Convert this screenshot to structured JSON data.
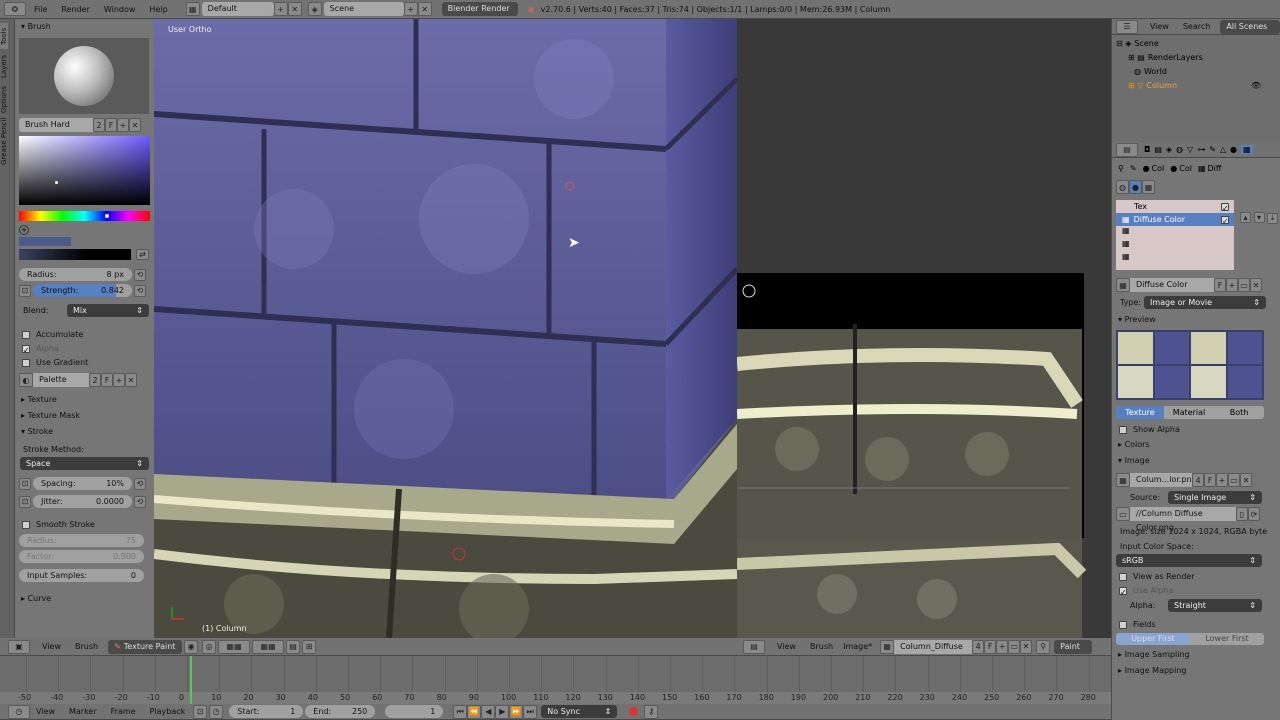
{
  "topbar": {
    "menus": [
      "File",
      "Render",
      "Window",
      "Help"
    ],
    "layout": "Default",
    "scene": "Scene",
    "engine": "Blender Render",
    "stats": "v2.70.6 | Verts:40 | Faces:37 | Tris:74 | Objects:1/1 | Lamps:0/0 | Mem:26.93M | Column"
  },
  "toolshelf": {
    "tabs": [
      "Tools",
      "Layers",
      "Options",
      "Grease Pencil"
    ],
    "brush_header": "Brush",
    "brush_name": "Brush Hard",
    "brush_users": "2",
    "brush_fake": "F",
    "radius_label": "Radius:",
    "radius_value": "8 px",
    "strength_label": "Strength:",
    "strength_value": "0.842",
    "blend_label": "Blend:",
    "blend_value": "Mix",
    "accumulate": "Accumulate",
    "alpha": "Alpha",
    "use_gradient": "Use Gradient",
    "palette": "Palette",
    "palette_users": "2",
    "palette_fake": "F",
    "texture": "Texture",
    "texture_mask": "Texture Mask",
    "stroke": "Stroke",
    "stroke_method_label": "Stroke Method:",
    "stroke_method": "Space",
    "spacing_label": "Spacing:",
    "spacing_value": "10%",
    "jitter_label": "Jitter:",
    "jitter_value": "0.0000",
    "smooth_stroke": "Smooth Stroke",
    "ss_radius_label": "Radius:",
    "ss_radius_value": "75",
    "ss_factor_label": "Factor:",
    "ss_factor_value": "0.900",
    "input_samples_label": "Input Samples:",
    "input_samples_value": "0",
    "curve": "Curve"
  },
  "viewport": {
    "view_label": "User Ortho",
    "object_label": "(1) Column",
    "header": {
      "view": "View",
      "brush": "Brush",
      "mode": "Texture Paint"
    }
  },
  "image_editor": {
    "header": {
      "view": "View",
      "brush": "Brush",
      "image": "Image*",
      "image_name": "Column_Diffuse Col...",
      "users": "4",
      "fake": "F",
      "mode": "Paint"
    }
  },
  "outliner": {
    "view": "View",
    "search": "Search",
    "filter": "All Scenes",
    "items": [
      "Scene",
      "RenderLayers",
      "World",
      "Column"
    ]
  },
  "properties": {
    "slot_names": [
      "Col",
      "Col",
      "Diff"
    ],
    "tex_list": [
      "Tex",
      "Diffuse Color"
    ],
    "tex_name": "Diffuse Color",
    "tex_fake": "F",
    "type_label": "Type:",
    "type_value": "Image or Movie",
    "preview": "Preview",
    "preview_tabs": [
      "Texture",
      "Material",
      "Both"
    ],
    "show_alpha": "Show Alpha",
    "colors": "Colors",
    "image": "Image",
    "image_name": "Colum...lor.png",
    "image_users": "4",
    "image_fake": "F",
    "source_label": "Source:",
    "source_value": "Single Image",
    "filepath": "//Column Diffuse Color.png",
    "image_info": "Image: size 1024 x 1024, RGBA byte",
    "input_color_space_label": "Input Color Space:",
    "input_color_space": "sRGB",
    "view_as_render": "View as Render",
    "use_alpha": "Use Alpha",
    "alpha_label": "Alpha:",
    "alpha_value": "Straight",
    "fields": "Fields",
    "field_order": [
      "Upper First",
      "Lower First"
    ],
    "image_sampling": "Image Sampling",
    "image_mapping": "Image Mapping"
  },
  "timeline": {
    "ticks": [
      "-50",
      "-40",
      "-30",
      "-20",
      "-10",
      "0",
      "10",
      "20",
      "30",
      "40",
      "50",
      "60",
      "70",
      "80",
      "90",
      "100",
      "110",
      "120",
      "130",
      "140",
      "150",
      "160",
      "170",
      "180",
      "190",
      "200",
      "210",
      "220",
      "230",
      "240",
      "250",
      "260",
      "270",
      "280"
    ],
    "menus": [
      "View",
      "Marker",
      "Frame",
      "Playback"
    ],
    "start_label": "Start:",
    "start": "1",
    "end_label": "End:",
    "end": "250",
    "current": "1",
    "sync": "No Sync"
  },
  "colors": {
    "accent": "#5680c2",
    "panel": "#767676",
    "header": "#727272"
  }
}
